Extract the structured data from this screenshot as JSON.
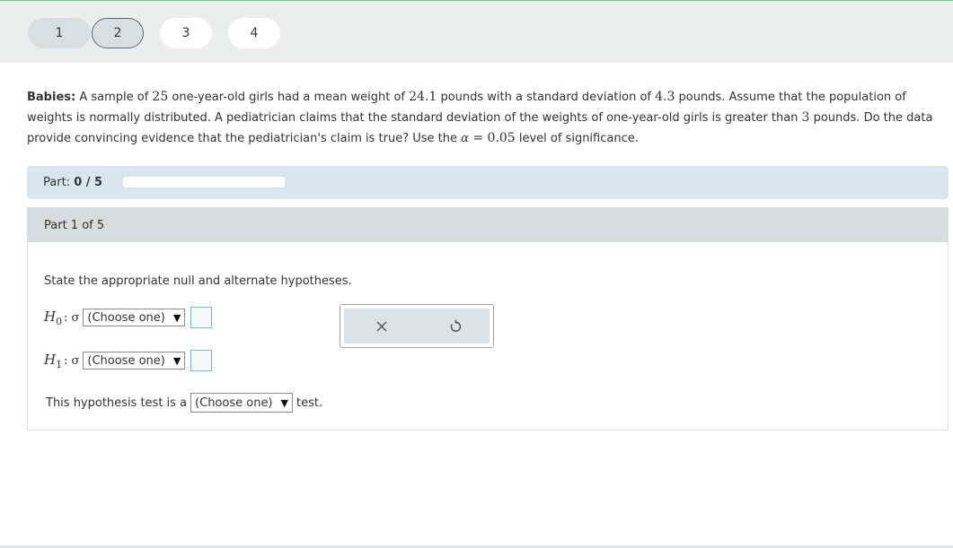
{
  "nav": {
    "questions": [
      "1",
      "2",
      "3",
      "4"
    ],
    "current": "2"
  },
  "problem": {
    "label": "Babies:",
    "t1": " A sample of ",
    "n": "25",
    "t2": " one-year-old girls had a mean weight of ",
    "mean": "24.1",
    "t3": " pounds with a standard deviation of ",
    "sd": "4.3",
    "t4": " pounds. Assume that the population of weights is normally distributed. A pediatrician claims that the standard deviation of the weights of one-year-old girls is greater than ",
    "claim": "3",
    "t5": " pounds. Do the data provide convincing evidence that the pediatrician's claim is true? Use the ",
    "alpha": "α",
    "eq": " = ",
    "alpha_val": "0.05",
    "t6": " level of significance."
  },
  "progress": {
    "label": "Part:",
    "value": "0 / 5",
    "fraction": 0
  },
  "part": {
    "header": "Part 1 of 5",
    "instruction": "State the appropriate null and alternate hypotheses.",
    "h0": {
      "symbol": "H",
      "sub": "0",
      "param": ": σ",
      "select": "(Choose one)"
    },
    "h1": {
      "symbol": "H",
      "sub": "1",
      "param": ": σ",
      "select": "(Choose one)"
    },
    "test_prefix": "This hypothesis test is a",
    "test_select": "(Choose one)",
    "test_suffix": "test."
  },
  "tools": {
    "clear": "×",
    "undo": "↺"
  },
  "colors": {
    "accent_green": "#7cc49a",
    "part_bar": "#dae6ee",
    "answer_box_border": "#7fb2d4"
  }
}
